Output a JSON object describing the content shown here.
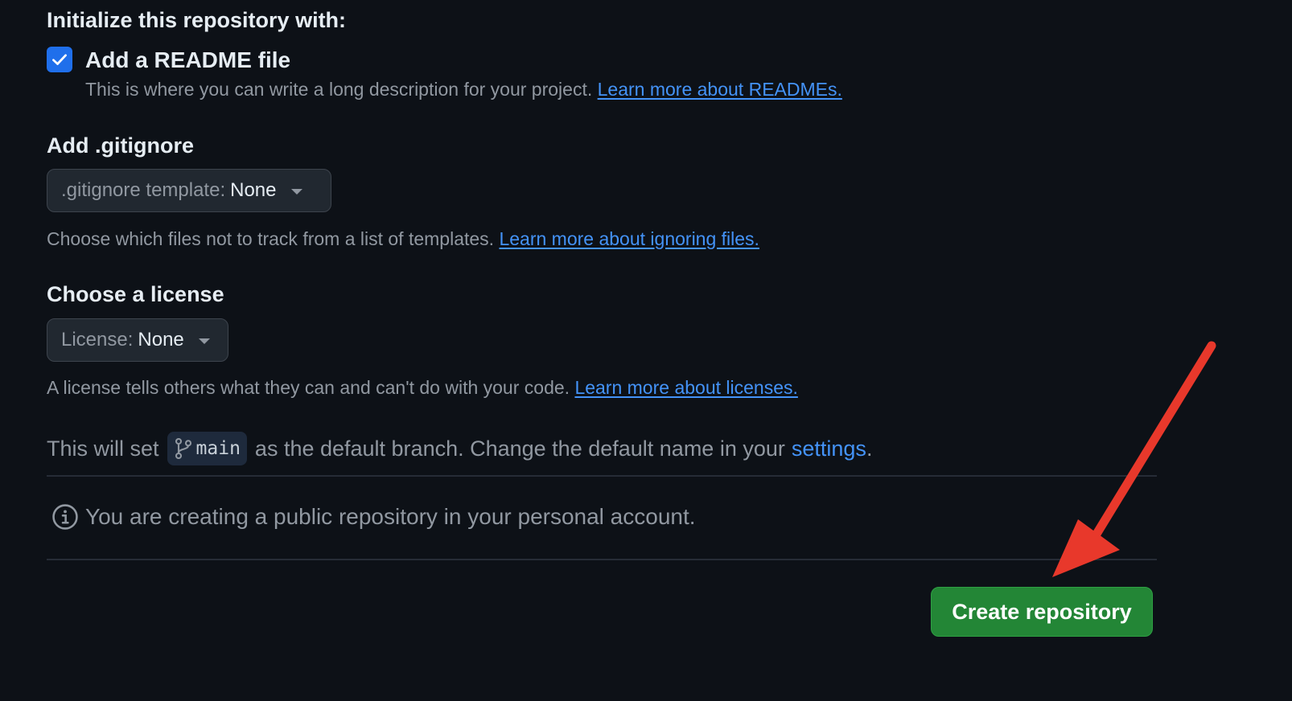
{
  "initialize": {
    "heading": "Initialize this repository with:",
    "readme": {
      "checked": true,
      "label": "Add a README file",
      "description": "This is where you can write a long description for your project.",
      "link": "Learn more about READMEs."
    }
  },
  "gitignore": {
    "heading": "Add .gitignore",
    "select_prefix": ".gitignore template:",
    "select_value": "None",
    "description": "Choose which files not to track from a list of templates.",
    "link": "Learn more about ignoring files."
  },
  "license": {
    "heading": "Choose a license",
    "select_prefix": "License:",
    "select_value": "None",
    "description": "A license tells others what they can and can't do with your code.",
    "link": "Learn more about licenses."
  },
  "branch": {
    "prefix": "This will set",
    "name": "main",
    "middle": "as the default branch. Change the default name in your",
    "settings_link": "settings",
    "suffix": "."
  },
  "notice": {
    "text": "You are creating a public repository in your personal account."
  },
  "actions": {
    "create_label": "Create repository"
  },
  "colors": {
    "background": "#0d1117",
    "link": "#4493f8",
    "primary_button": "#238636",
    "annotation_arrow": "#e8382b"
  },
  "icons": {
    "checkbox": "check-icon",
    "dropdown": "caret-down-icon",
    "branch": "git-branch-icon",
    "info": "info-icon",
    "annotation": "red-arrow-annotation"
  }
}
